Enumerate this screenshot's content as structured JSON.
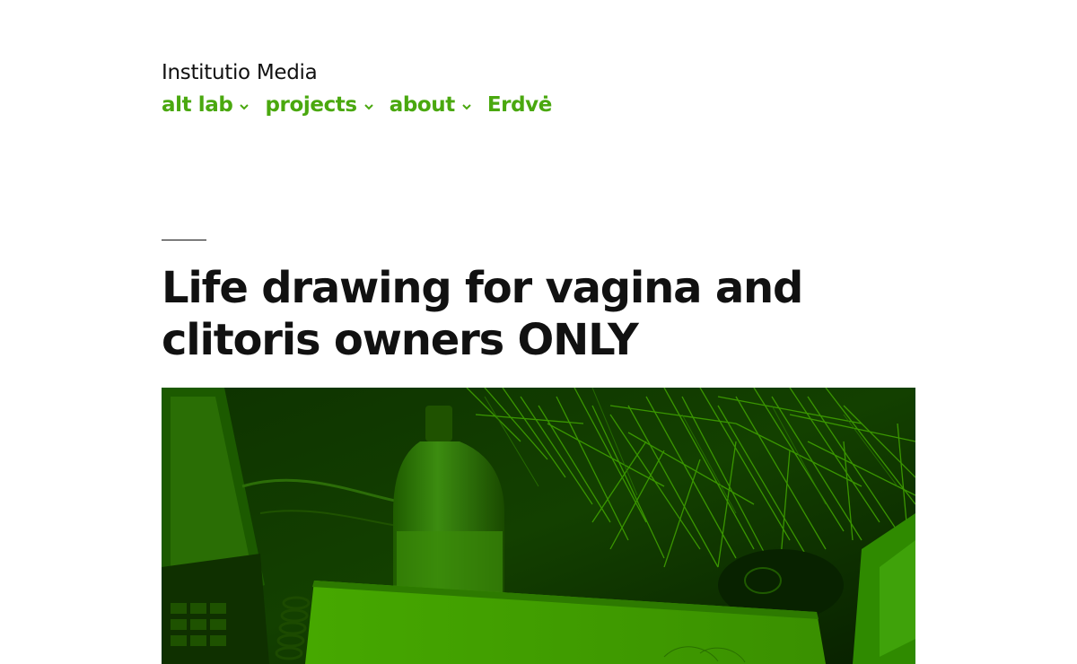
{
  "site": {
    "title": "Institutio Media"
  },
  "nav": {
    "items": [
      {
        "label": "alt lab",
        "has_submenu": true
      },
      {
        "label": "projects",
        "has_submenu": true
      },
      {
        "label": "about",
        "has_submenu": true
      },
      {
        "label": "Erdvė",
        "has_submenu": false
      }
    ]
  },
  "post": {
    "title": "Life drawing for vagina and clitoris owners ONLY"
  },
  "colors": {
    "accent": "#4aa80f",
    "text": "#111111",
    "background": "#ffffff",
    "image_tint": "#2f8a00"
  }
}
